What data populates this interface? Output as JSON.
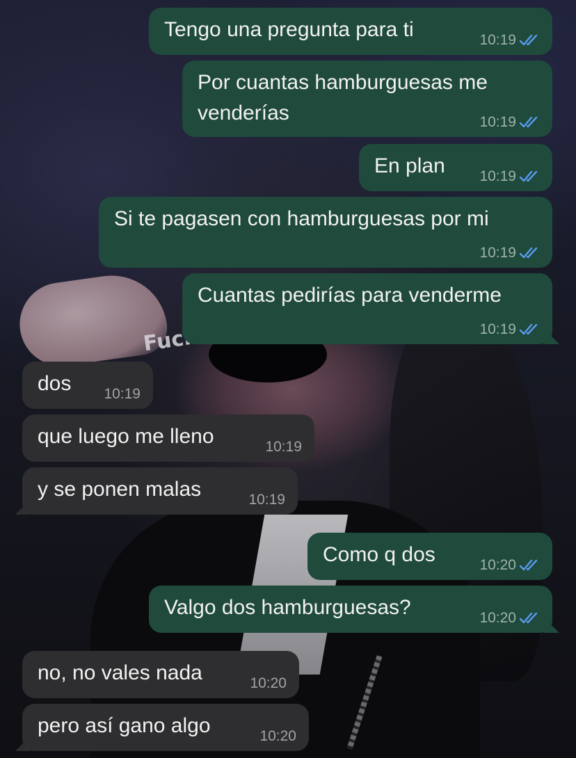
{
  "colors": {
    "outgoing_bubble": "#1f4a3c",
    "incoming_bubble": "#2e2e30",
    "read_ticks": "#5b9bf0",
    "message_text": "#f2f2f2"
  },
  "wallpaper": {
    "shirt_text": "Fuck"
  },
  "messages": [
    {
      "direction": "outgoing",
      "text": "Tengo una pregunta para ti",
      "time": "10:19",
      "status": "read"
    },
    {
      "direction": "outgoing",
      "text_lines": [
        "Por cuantas hamburguesas me",
        "venderías"
      ],
      "time": "10:19",
      "status": "read"
    },
    {
      "direction": "outgoing",
      "text": "En plan",
      "time": "10:19",
      "status": "read"
    },
    {
      "direction": "outgoing",
      "text": "Si te pagasen con hamburguesas por mi",
      "time": "10:19",
      "status": "read"
    },
    {
      "direction": "outgoing",
      "text": "Cuantas pedirías para venderme",
      "time": "10:19",
      "status": "read"
    },
    {
      "direction": "incoming",
      "text": "dos",
      "time": "10:19"
    },
    {
      "direction": "incoming",
      "text": "que luego me lleno",
      "time": "10:19"
    },
    {
      "direction": "incoming",
      "text": "y se ponen malas",
      "time": "10:19"
    },
    {
      "direction": "outgoing",
      "text": "Como q dos",
      "time": "10:20",
      "status": "read"
    },
    {
      "direction": "outgoing",
      "text": "Valgo dos hamburguesas?",
      "time": "10:20",
      "status": "read"
    },
    {
      "direction": "incoming",
      "text": "no, no vales nada",
      "time": "10:20"
    },
    {
      "direction": "incoming",
      "text": "pero así gano algo",
      "time": "10:20"
    }
  ]
}
